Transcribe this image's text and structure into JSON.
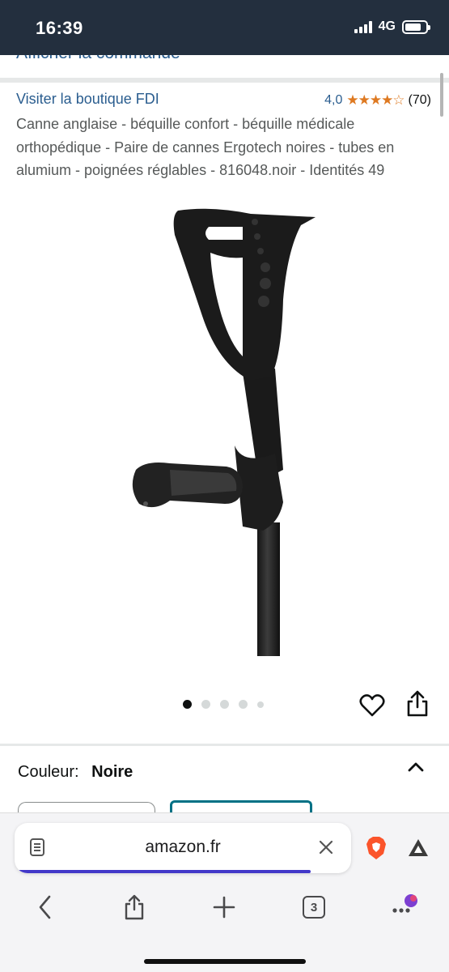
{
  "status_bar": {
    "time": "16:39",
    "network": "4G"
  },
  "top_partial_link": "Afficher la commande",
  "product": {
    "store_link": "Visiter la boutique FDI",
    "rating_value": "4,0",
    "rating_stars": 4,
    "rating_count": "(70)",
    "title": "Canne anglaise - béquille confort - béquille médicale orthopédique - Paire de cannes Ergotech noires - tubes en alumium - poignées réglables - 816048.noir - Identités 49",
    "image_dots": 5,
    "active_dot": 1
  },
  "variation": {
    "label": "Couleur:",
    "value": "Noire"
  },
  "browser": {
    "url": "amazon.fr",
    "load_progress": 0.88,
    "tab_count": "3"
  },
  "colors": {
    "status_bg": "#232f3e",
    "link": "#2a5d8f",
    "star": "#de7921",
    "progress": "#4238c9",
    "selected_swatch": "#007185"
  }
}
